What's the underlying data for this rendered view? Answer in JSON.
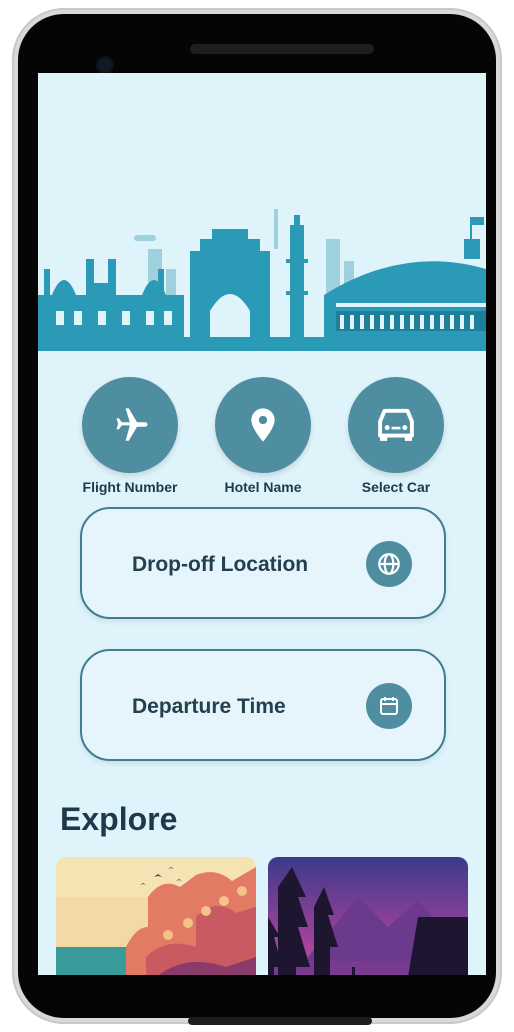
{
  "quick_actions": [
    {
      "label": "Flight Number",
      "icon": "airplane-icon"
    },
    {
      "label": "Hotel Name",
      "icon": "location-pin-icon"
    },
    {
      "label": "Select Car",
      "icon": "car-icon"
    }
  ],
  "fields": {
    "dropoff": {
      "label": "Drop-off Location",
      "icon": "globe-icon"
    },
    "departure": {
      "label": "Departure Time",
      "icon": "calendar-icon"
    }
  },
  "explore": {
    "title": "Explore",
    "cards": [
      {
        "image": "palace-illustration"
      },
      {
        "image": "lake-forest-illustration"
      }
    ]
  },
  "colors": {
    "screen_bg": "#dff3fb",
    "accent": "#4f8ea0",
    "skyline": "#2b9ab6",
    "text_dark": "#1d3a4a"
  }
}
